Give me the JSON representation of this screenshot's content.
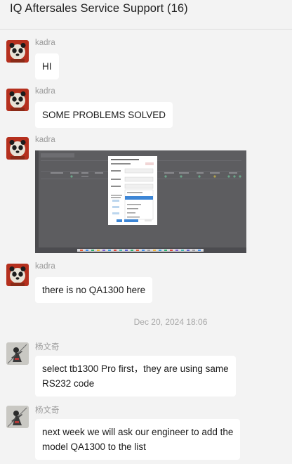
{
  "header": {
    "title": "IQ Aftersales Service Support  (16)"
  },
  "messages": [
    {
      "sender": "kadra",
      "text": "HI"
    },
    {
      "sender": "kadra",
      "text": "SOME PROBLEMS SOLVED"
    },
    {
      "sender": "kadra",
      "image": "screenshot-image"
    },
    {
      "sender": "kadra",
      "text": "there is no QA1300 here"
    },
    {
      "sender": "杨文奇",
      "lines": [
        "select tb1300 Pro first，they are using same",
        "RS232 code"
      ]
    },
    {
      "sender": "杨文奇",
      "lines": [
        "next week we will ask our engineer to add the",
        "model QA1300 to the list"
      ]
    }
  ],
  "timestamp": "Dec 20, 2024 18:06",
  "colors": {
    "background": "#f3f3f3",
    "bubble": "#ffffff",
    "meta_text": "#9a9a9a"
  }
}
